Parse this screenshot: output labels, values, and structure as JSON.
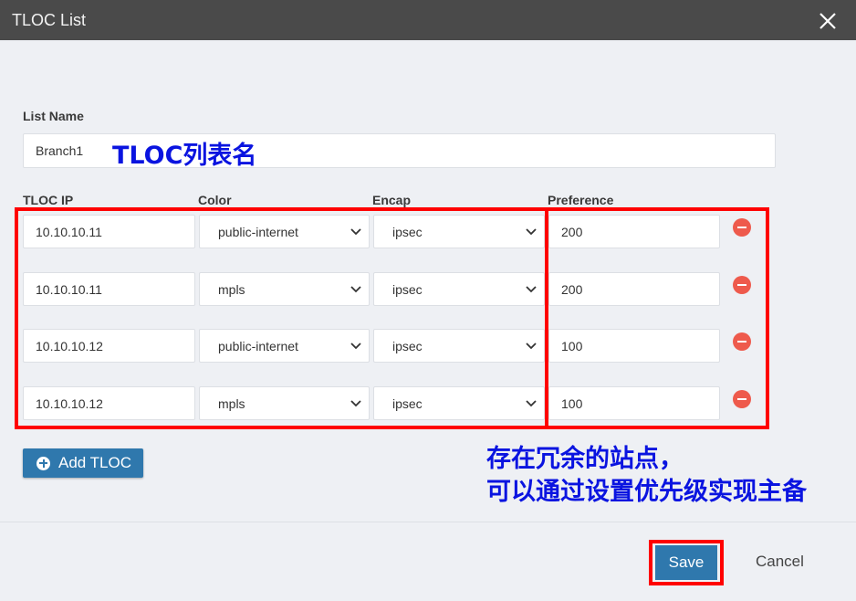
{
  "dialog": {
    "title": "TLOC List"
  },
  "list_name": {
    "label": "List Name",
    "value": "Branch1"
  },
  "columns": {
    "tloc_ip": "TLOC IP",
    "color": "Color",
    "encap": "Encap",
    "preference": "Preference"
  },
  "rows": [
    {
      "ip": "10.10.10.11",
      "color": "public-internet",
      "encap": "ipsec",
      "preference": "200"
    },
    {
      "ip": "10.10.10.11",
      "color": "mpls",
      "encap": "ipsec",
      "preference": "200"
    },
    {
      "ip": "10.10.10.12",
      "color": "public-internet",
      "encap": "ipsec",
      "preference": "100"
    },
    {
      "ip": "10.10.10.12",
      "color": "mpls",
      "encap": "ipsec",
      "preference": "100"
    }
  ],
  "buttons": {
    "add_tloc": "Add TLOC",
    "save": "Save",
    "cancel": "Cancel"
  },
  "annotations": {
    "list_name_note": "TLOC列表名",
    "redundancy_line1": "存在冗余的站点，",
    "redundancy_line2": "可以通过设置优先级实现主备"
  },
  "icons": {
    "close": "close-icon",
    "dropdown": "chevron-down-icon",
    "remove": "remove-row-icon",
    "add": "plus-circle-icon"
  },
  "colors": {
    "titlebar": "#4a4a4a",
    "primary": "#2f78ad",
    "remove": "#ee5a4c",
    "highlight": "#ff0000",
    "annotation": "#0a14e0"
  }
}
